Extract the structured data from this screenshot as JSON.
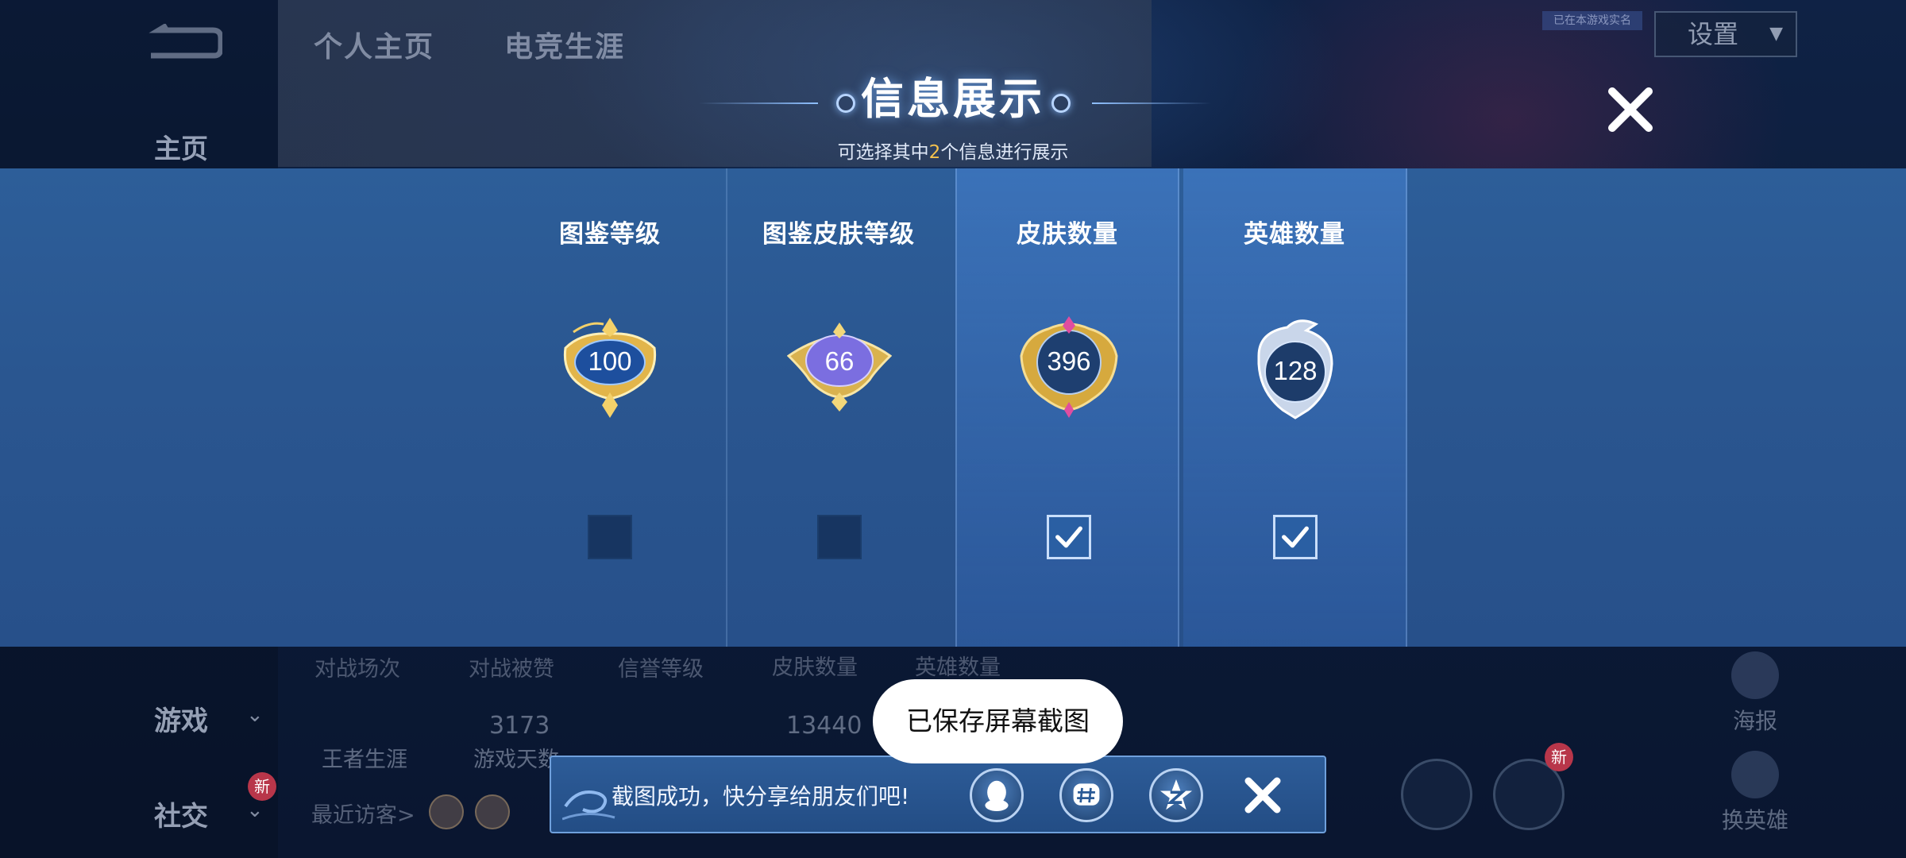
{
  "background": {
    "tabs": [
      "个人主页",
      "电竞生涯"
    ],
    "sidebar": {
      "home": "主页",
      "game": "游戏",
      "social": "社交",
      "new_badge": "新"
    },
    "settings_label": "设置",
    "top_badge": "已在本游戏实名",
    "stats_labels": [
      "对战场次",
      "对战被赞",
      "信誉等级",
      "皮肤数量",
      "英雄数量"
    ],
    "stats_values": [
      "3173",
      "13440"
    ],
    "career_label": "王者生涯",
    "game_days_label": "游戏天数",
    "recent_visitors": "最近访客>",
    "right_actions": [
      "海报",
      "换英雄"
    ],
    "circle_badge": "新"
  },
  "modal": {
    "title": "信息展示",
    "subtitle_prefix": "可选择其中",
    "subtitle_count": "2",
    "subtitle_suffix": "个信息进行展示",
    "options": [
      {
        "label": "图鉴等级",
        "value": "100",
        "checked": false
      },
      {
        "label": "图鉴皮肤等级",
        "value": "66",
        "checked": false
      },
      {
        "label": "皮肤数量",
        "value": "396",
        "checked": true
      },
      {
        "label": "英雄数量",
        "value": "128",
        "checked": true
      }
    ]
  },
  "toast": {
    "text": "已保存屏幕截图"
  },
  "share_bar": {
    "text": "截图成功，快分享给朋友们吧!",
    "icons": [
      "qq-icon",
      "moments-icon",
      "qzone-icon"
    ]
  }
}
